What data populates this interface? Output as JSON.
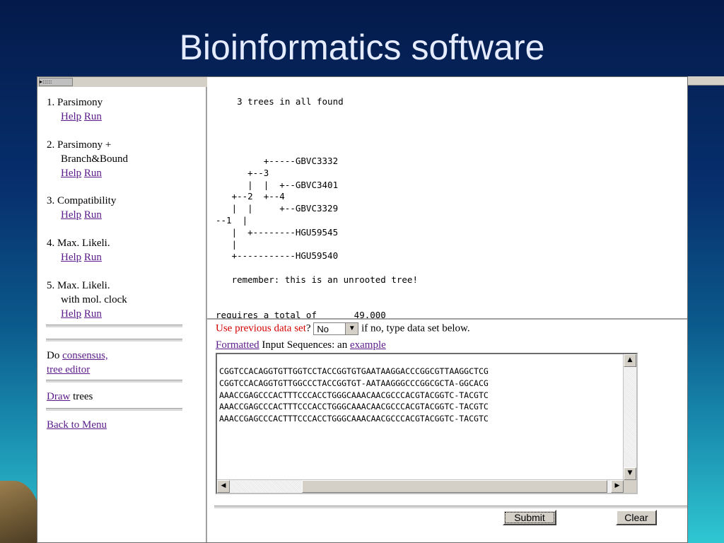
{
  "slide": {
    "title": "Bioinformatics software"
  },
  "nav": {
    "items": [
      {
        "number_label": "1. Parsimony",
        "help": "Help",
        "run": "Run"
      },
      {
        "number_label": "2. Parsimony +",
        "second_line": "Branch&Bound",
        "help": "Help",
        "run": "Run"
      },
      {
        "number_label": "3. Compatibility",
        "help": "Help",
        "run": "Run"
      },
      {
        "number_label": "4. Max. Likeli.",
        "help": "Help",
        "run": "Run"
      },
      {
        "number_label": "5. Max. Likeli.",
        "second_line": "with mol. clock",
        "help": "Help",
        "run": "Run"
      }
    ],
    "do_prefix": "Do",
    "consensus_link": "consensus,",
    "tree_editor_link": "tree editor",
    "draw_link": "Draw",
    "draw_suffix": "trees",
    "back_link": "Back to Menu"
  },
  "output": {
    "text": "    3 trees in all found\n\n\n\n\n         +-----GBVC3332\n      +--3\n      |  |  +--GBVC3401\n   +--2  +--4\n   |  |     +--GBVC3329\n--1  |\n   |  +--------HGU59545\n   |\n   +-----------HGU59540\n\n   remember: this is an unrooted tree!\n\n\nrequires a total of       49.000"
  },
  "form": {
    "use_previous_label": "Use previous data set",
    "question_mark": "?",
    "select_value": "No",
    "if_no_text": "if no, type data set below.",
    "formatted_link": "Formatted",
    "input_seq_text": " Input Sequences: an ",
    "example_link": "example ",
    "sequences": "CGGTCCACAGGTGTTGGTCCTACCGGTGTGAATAAGGACCCGGCGTTAAGGCTCG\nCGGTCCACAGGTGTTGGCCCTACCGGTGT-AATAAGGGCCCGGCGCTA-GGCACG\nAAACCGAGCCCACTTTCCCACCTGGGCAAACAACGCCCACGTACGGTC-TACGTC\nAAACCGAGCCCACTTTCCCACCTGGGCAAACAACGCCCACGTACGGTC-TACGTC\nAAACCGAGCCCACTTTCCCACCTGGGCAAACAACGCCCACGTACGGTC-TACGTC",
    "submit_label": "Submit",
    "clear_label": "Clear"
  }
}
